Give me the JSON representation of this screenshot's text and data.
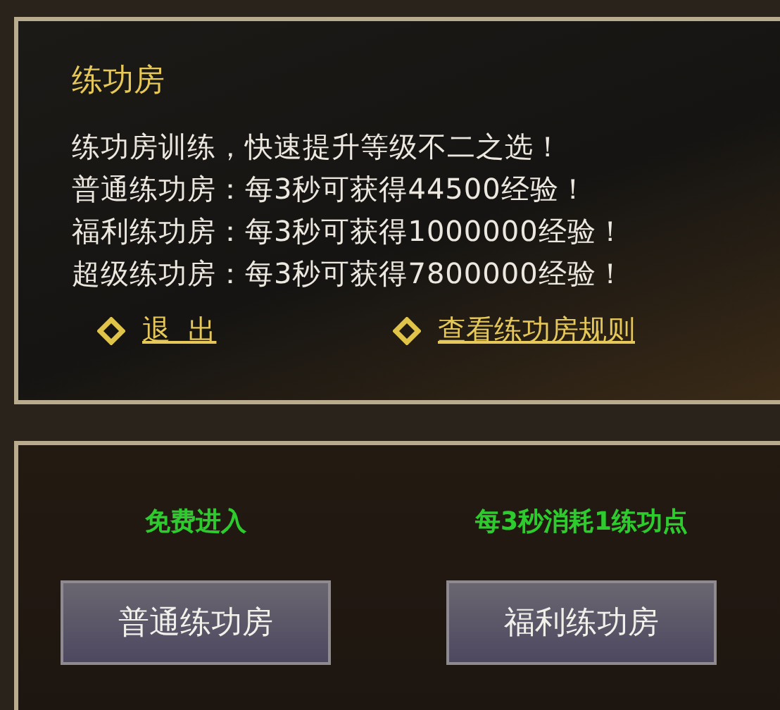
{
  "info_panel": {
    "title": "练功房",
    "lines": [
      "练功房训练，快速提升等级不二之选！",
      "普通练功房：每3秒可获得44500经验！",
      "福利练功房：每3秒可获得1000000经验！",
      "超级练功房：每3秒可获得7800000经验！"
    ],
    "links": [
      {
        "label": "退  出"
      },
      {
        "label": "查看练功房规则"
      }
    ]
  },
  "rooms": [
    {
      "note": "免费进入",
      "button": "普通练功房"
    },
    {
      "note": "每3秒消耗1练功点",
      "button": "福利练功房"
    }
  ]
}
